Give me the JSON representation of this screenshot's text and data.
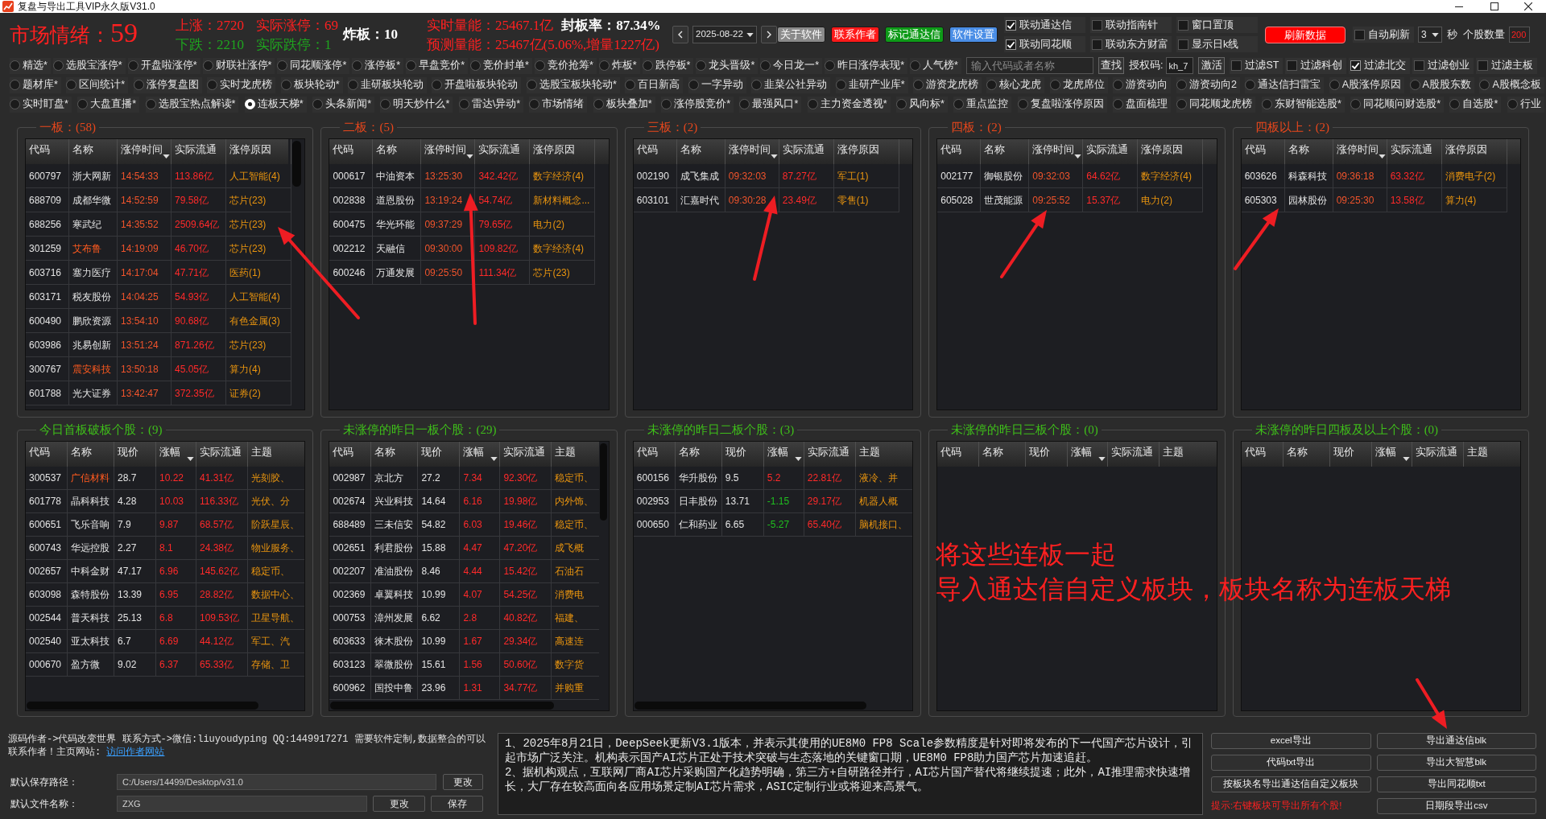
{
  "window": {
    "title": "复盘与导出工具VIP永久版V31.0"
  },
  "sentiment": {
    "label": "市场情绪：",
    "value": "59"
  },
  "stats": [
    {
      "text": "上涨：2720",
      "color": "#ff2020"
    },
    {
      "text": "实际涨停：69",
      "color": "#ff2020"
    },
    {
      "text": "下跌：2210",
      "color": "#1fa51f"
    },
    {
      "text": "实际跌停：1",
      "color": "#1fa51f"
    }
  ],
  "broken_boards": "炸板：10",
  "volume": {
    "realtime": "实时量能：25467.1亿",
    "seal_rate": "封板率：87.34%",
    "forecast": "预测量能：25467亿(5.06%,增量1227亿)"
  },
  "date_nav": {
    "date": "2025-08-22"
  },
  "top_buttons": [
    {
      "label": "关于软件",
      "color": "#8a8a8a"
    },
    {
      "label": "联系作者",
      "color": "#ff1a1a"
    },
    {
      "label": "标记通达信",
      "color": "#0e9a18"
    },
    {
      "label": "软件设置",
      "color": "#4a8ee6"
    }
  ],
  "sync_options": [
    {
      "label": "联动通达信",
      "checked": true
    },
    {
      "label": "联动指南针",
      "checked": false
    },
    {
      "label": "窗口置顶",
      "checked": false
    },
    {
      "label": "联动同花顺",
      "checked": true
    },
    {
      "label": "联动东方财富",
      "checked": false
    },
    {
      "label": "显示日k线",
      "checked": false
    }
  ],
  "refresh_button": "刷新数据",
  "auto_refresh": {
    "label": "自动刷新",
    "checked": false,
    "interval": "3",
    "unit": "秒"
  },
  "stock_count": {
    "label": "个股数量",
    "value": "200"
  },
  "view_rows": [
    {
      "items": [
        {
          "label": "精选*",
          "selected": false
        },
        {
          "label": "选股宝涨停*",
          "selected": false
        },
        {
          "label": "开盘啦涨停*",
          "selected": false
        },
        {
          "label": "财联社涨停*",
          "selected": false
        },
        {
          "label": "同花顺涨停*",
          "selected": false
        },
        {
          "label": "涨停板*",
          "selected": false
        },
        {
          "label": "早盘竞价*",
          "selected": false
        },
        {
          "label": "竞价封单*",
          "selected": false
        },
        {
          "label": "竞价抢筹*",
          "selected": false
        },
        {
          "label": "炸板*",
          "selected": false
        },
        {
          "label": "跌停板*",
          "selected": false
        },
        {
          "label": "龙头晋级*",
          "selected": false
        },
        {
          "label": "今日龙一*",
          "selected": false
        },
        {
          "label": "昨日涨停表现*",
          "selected": false
        },
        {
          "label": "人气榜*",
          "selected": false
        }
      ]
    },
    {
      "items": [
        {
          "label": "题材库*",
          "selected": false
        },
        {
          "label": "区间统计*",
          "selected": false
        },
        {
          "label": "涨停复盘图",
          "selected": false
        },
        {
          "label": "实时龙虎榜",
          "selected": false
        },
        {
          "label": "板块轮动*",
          "selected": false
        },
        {
          "label": "韭研板块轮动",
          "selected": false
        },
        {
          "label": "开盘啦板块轮动",
          "selected": false
        },
        {
          "label": "选股宝板块轮动*",
          "selected": false
        },
        {
          "label": "百日新高",
          "selected": false
        },
        {
          "label": "一字异动",
          "selected": false
        },
        {
          "label": "韭菜公社异动",
          "selected": false
        },
        {
          "label": "韭研产业库*",
          "selected": false
        },
        {
          "label": "游资龙虎榜",
          "selected": false
        },
        {
          "label": "核心龙虎",
          "selected": false
        },
        {
          "label": "龙虎席位",
          "selected": false
        },
        {
          "label": "游资动向",
          "selected": false
        },
        {
          "label": "游资动向2",
          "selected": false
        },
        {
          "label": "通达信扫雷宝",
          "selected": false
        },
        {
          "label": "A股涨停原因",
          "selected": false
        },
        {
          "label": "A股股东数",
          "selected": false
        },
        {
          "label": "A股概念板",
          "selected": false
        }
      ]
    },
    {
      "items": [
        {
          "label": "实时盯盘*",
          "selected": false
        },
        {
          "label": "大盘直播*",
          "selected": false
        },
        {
          "label": "选股宝热点解读*",
          "selected": false
        },
        {
          "label": "连板天梯*",
          "selected": true
        },
        {
          "label": "头条新闻*",
          "selected": false
        },
        {
          "label": "明天炒什么*",
          "selected": false
        },
        {
          "label": "雷达\\异动*",
          "selected": false
        },
        {
          "label": "市场情绪",
          "selected": false
        },
        {
          "label": "板块叠加*",
          "selected": false
        },
        {
          "label": "涨停股竞价*",
          "selected": false
        },
        {
          "label": "最强风口*",
          "selected": false
        },
        {
          "label": "主力资金透视*",
          "selected": false
        },
        {
          "label": "风向标*",
          "selected": false
        },
        {
          "label": "重点监控",
          "selected": false
        },
        {
          "label": "复盘啦涨停原因",
          "selected": false
        },
        {
          "label": "盘面梳理",
          "selected": false
        },
        {
          "label": "同花顺龙虎榜",
          "selected": false
        },
        {
          "label": "东财智能选股*",
          "selected": false
        },
        {
          "label": "同花顺问财选股*",
          "selected": false
        },
        {
          "label": "自选股*",
          "selected": false
        },
        {
          "label": "行业",
          "selected": false
        }
      ]
    }
  ],
  "search": {
    "placeholder": "输入代码或者名称",
    "button": "查找"
  },
  "license": {
    "label": "授权码:",
    "value": "kh_7",
    "button": "激活"
  },
  "filters": [
    {
      "label": "过滤ST",
      "checked": false
    },
    {
      "label": "过滤科创",
      "checked": false
    },
    {
      "label": "过滤北交",
      "checked": true
    },
    {
      "label": "过滤创业",
      "checked": false
    },
    {
      "label": "过滤主板",
      "checked": false
    }
  ],
  "limit_panels": [
    {
      "title": "一板：(58)",
      "columns": [
        {
          "label": "代码",
          "sorted": false
        },
        {
          "label": "名称",
          "sorted": false
        },
        {
          "label": "涨停时间",
          "sorted": true
        },
        {
          "label": "实际流通",
          "sorted": false
        },
        {
          "label": "涨停原因",
          "sorted": false
        }
      ],
      "rows": [
        {
          "code": "600797",
          "name": "浙大网新",
          "highlighted": false,
          "time": "14:54:33",
          "float": "113.86亿",
          "reason": "人工智能(4)"
        },
        {
          "code": "688709",
          "name": "成都华微",
          "highlighted": false,
          "time": "14:52:59",
          "float": "79.58亿",
          "reason": "芯片(23)"
        },
        {
          "code": "688256",
          "name": "寒武纪",
          "highlighted": false,
          "time": "14:35:52",
          "float": "2509.64亿",
          "reason": "芯片(23)"
        },
        {
          "code": "301259",
          "name": "艾布鲁",
          "highlighted": true,
          "time": "14:19:09",
          "float": "46.70亿",
          "reason": "芯片(23)"
        },
        {
          "code": "603716",
          "name": "塞力医疗",
          "highlighted": false,
          "time": "14:17:04",
          "float": "47.71亿",
          "reason": "医药(1)"
        },
        {
          "code": "603171",
          "name": "税友股份",
          "highlighted": false,
          "time": "14:04:25",
          "float": "54.93亿",
          "reason": "人工智能(4)"
        },
        {
          "code": "600490",
          "name": "鹏欣资源",
          "highlighted": false,
          "time": "13:54:10",
          "float": "90.68亿",
          "reason": "有色金属(3)"
        },
        {
          "code": "603986",
          "name": "兆易创新",
          "highlighted": false,
          "time": "13:51:24",
          "float": "871.26亿",
          "reason": "芯片(23)"
        },
        {
          "code": "300767",
          "name": "震安科技",
          "highlighted": true,
          "time": "13:50:18",
          "float": "45.05亿",
          "reason": "算力(4)"
        },
        {
          "code": "601788",
          "name": "光大证券",
          "highlighted": false,
          "time": "13:42:47",
          "float": "372.35亿",
          "reason": "证券(2)"
        }
      ]
    },
    {
      "title": "二板：(5)",
      "columns": [
        {
          "label": "代码",
          "sorted": false
        },
        {
          "label": "名称",
          "sorted": false
        },
        {
          "label": "涨停时间",
          "sorted": true
        },
        {
          "label": "实际流通",
          "sorted": false
        },
        {
          "label": "涨停原因",
          "sorted": false
        }
      ],
      "rows": [
        {
          "code": "000617",
          "name": "中油资本",
          "highlighted": false,
          "time": "13:25:30",
          "float": "342.42亿",
          "reason": "数字经济(4)"
        },
        {
          "code": "002838",
          "name": "道恩股份",
          "highlighted": false,
          "time": "13:19:24",
          "float": "54.74亿",
          "reason": "新材料概念..."
        },
        {
          "code": "600475",
          "name": "华光环能",
          "highlighted": false,
          "time": "09:37:29",
          "float": "79.65亿",
          "reason": "电力(2)"
        },
        {
          "code": "002212",
          "name": "天融信",
          "highlighted": false,
          "time": "09:30:00",
          "float": "109.82亿",
          "reason": "数字经济(4)"
        },
        {
          "code": "600246",
          "name": "万通发展",
          "highlighted": false,
          "time": "09:25:50",
          "float": "111.34亿",
          "reason": "芯片(23)"
        }
      ]
    },
    {
      "title": "三板：(2)",
      "columns": [
        {
          "label": "代码",
          "sorted": false
        },
        {
          "label": "名称",
          "sorted": false
        },
        {
          "label": "涨停时间",
          "sorted": true
        },
        {
          "label": "实际流通",
          "sorted": false
        },
        {
          "label": "涨停原因",
          "sorted": false
        }
      ],
      "rows": [
        {
          "code": "002190",
          "name": "成飞集成",
          "highlighted": false,
          "time": "09:32:03",
          "float": "87.27亿",
          "reason": "军工(1)"
        },
        {
          "code": "603101",
          "name": "汇嘉时代",
          "highlighted": false,
          "time": "09:30:28",
          "float": "23.49亿",
          "reason": "零售(1)"
        }
      ]
    },
    {
      "title": "四板：(2)",
      "columns": [
        {
          "label": "代码",
          "sorted": false
        },
        {
          "label": "名称",
          "sorted": false
        },
        {
          "label": "涨停时间",
          "sorted": true
        },
        {
          "label": "实际流通",
          "sorted": false
        },
        {
          "label": "涨停原因",
          "sorted": false
        }
      ],
      "rows": [
        {
          "code": "002177",
          "name": "御银股份",
          "highlighted": false,
          "time": "09:32:03",
          "float": "64.62亿",
          "reason": "数字经济(4)"
        },
        {
          "code": "605028",
          "name": "世茂能源",
          "highlighted": false,
          "time": "09:25:52",
          "float": "15.37亿",
          "reason": "电力(2)"
        }
      ]
    },
    {
      "title": "四板以上：(2)",
      "columns": [
        {
          "label": "代码",
          "sorted": false
        },
        {
          "label": "名称",
          "sorted": false
        },
        {
          "label": "涨停时间",
          "sorted": true
        },
        {
          "label": "实际流通",
          "sorted": false
        },
        {
          "label": "涨停原因",
          "sorted": false
        }
      ],
      "rows": [
        {
          "code": "603626",
          "name": "科森科技",
          "highlighted": false,
          "time": "09:36:18",
          "float": "63.32亿",
          "reason": "消费电子(2)"
        },
        {
          "code": "605303",
          "name": "园林股份",
          "highlighted": false,
          "time": "09:25:30",
          "float": "13.58亿",
          "reason": "算力(4)"
        }
      ]
    }
  ],
  "unsealed_panels": [
    {
      "title": "今日首板破板个股：(9)",
      "columns": [
        {
          "label": "代码",
          "sorted": false
        },
        {
          "label": "名称",
          "sorted": false
        },
        {
          "label": "现价",
          "sorted": false
        },
        {
          "label": "涨幅",
          "sorted": true
        },
        {
          "label": "实际流通",
          "sorted": false
        },
        {
          "label": "主题",
          "sorted": false
        }
      ],
      "rows": [
        {
          "code": "300537",
          "name": "广信材料",
          "highlighted": true,
          "price": "28.7",
          "change": "10.22",
          "rising": true,
          "float": "41.31亿",
          "theme": "光刻胶、"
        },
        {
          "code": "601778",
          "name": "晶科科技",
          "highlighted": false,
          "price": "4.28",
          "change": "10.03",
          "rising": true,
          "float": "116.33亿",
          "theme": "光伏、分"
        },
        {
          "code": "600651",
          "name": "飞乐音响",
          "highlighted": false,
          "price": "7.9",
          "change": "9.87",
          "rising": true,
          "float": "68.57亿",
          "theme": "阶跃星辰、"
        },
        {
          "code": "600743",
          "name": "华远控股",
          "highlighted": false,
          "price": "2.27",
          "change": "8.1",
          "rising": true,
          "float": "24.38亿",
          "theme": "物业服务、"
        },
        {
          "code": "002657",
          "name": "中科金财",
          "highlighted": false,
          "price": "47.17",
          "change": "6.96",
          "rising": true,
          "float": "145.62亿",
          "theme": "稳定币、"
        },
        {
          "code": "603098",
          "name": "森特股份",
          "highlighted": false,
          "price": "13.39",
          "change": "6.95",
          "rising": true,
          "float": "28.82亿",
          "theme": "数据中心、"
        },
        {
          "code": "002544",
          "name": "普天科技",
          "highlighted": false,
          "price": "25.13",
          "change": "6.8",
          "rising": true,
          "float": "109.53亿",
          "theme": "卫星导航、"
        },
        {
          "code": "002540",
          "name": "亚太科技",
          "highlighted": false,
          "price": "6.7",
          "change": "6.69",
          "rising": true,
          "float": "44.12亿",
          "theme": "军工、汽"
        },
        {
          "code": "000670",
          "name": "盈方微",
          "highlighted": false,
          "price": "9.02",
          "change": "6.37",
          "rising": true,
          "float": "65.33亿",
          "theme": "存储、卫"
        }
      ]
    },
    {
      "title": "未涨停的昨日一板个股：(29)",
      "columns": [
        {
          "label": "代码",
          "sorted": false
        },
        {
          "label": "名称",
          "sorted": false
        },
        {
          "label": "现价",
          "sorted": false
        },
        {
          "label": "涨幅",
          "sorted": true
        },
        {
          "label": "实际流通",
          "sorted": false
        },
        {
          "label": "主题",
          "sorted": false
        }
      ],
      "rows": [
        {
          "code": "002987",
          "name": "京北方",
          "highlighted": false,
          "price": "27.2",
          "change": "7.34",
          "rising": true,
          "float": "92.30亿",
          "theme": "稳定币、"
        },
        {
          "code": "002674",
          "name": "兴业科技",
          "highlighted": false,
          "price": "14.64",
          "change": "6.16",
          "rising": true,
          "float": "19.98亿",
          "theme": "内外饰、"
        },
        {
          "code": "688489",
          "name": "三未信安",
          "highlighted": false,
          "price": "54.82",
          "change": "6.03",
          "rising": true,
          "float": "19.46亿",
          "theme": "稳定币、"
        },
        {
          "code": "002651",
          "name": "利君股份",
          "highlighted": false,
          "price": "15.88",
          "change": "4.47",
          "rising": true,
          "float": "47.20亿",
          "theme": "成飞概"
        },
        {
          "code": "002207",
          "name": "准油股份",
          "highlighted": false,
          "price": "8.46",
          "change": "4.44",
          "rising": true,
          "float": "15.42亿",
          "theme": "石油石"
        },
        {
          "code": "002369",
          "name": "卓翼科技",
          "highlighted": false,
          "price": "10.99",
          "change": "4.07",
          "rising": true,
          "float": "54.25亿",
          "theme": "消费电"
        },
        {
          "code": "000753",
          "name": "漳州发展",
          "highlighted": false,
          "price": "6.62",
          "change": "2.8",
          "rising": true,
          "float": "40.82亿",
          "theme": "福建、"
        },
        {
          "code": "603633",
          "name": "徕木股份",
          "highlighted": false,
          "price": "10.99",
          "change": "1.67",
          "rising": true,
          "float": "29.34亿",
          "theme": "高速连"
        },
        {
          "code": "603123",
          "name": "翠微股份",
          "highlighted": false,
          "price": "15.61",
          "change": "1.56",
          "rising": true,
          "float": "50.60亿",
          "theme": "数字货"
        },
        {
          "code": "600962",
          "name": "国投中鲁",
          "highlighted": false,
          "price": "23.96",
          "change": "1.31",
          "rising": true,
          "float": "34.77亿",
          "theme": "并购重"
        }
      ]
    },
    {
      "title": "未涨停的昨日二板个股：(3)",
      "columns": [
        {
          "label": "代码",
          "sorted": false
        },
        {
          "label": "名称",
          "sorted": false
        },
        {
          "label": "现价",
          "sorted": false
        },
        {
          "label": "涨幅",
          "sorted": true
        },
        {
          "label": "实际流通",
          "sorted": false
        },
        {
          "label": "主题",
          "sorted": false
        }
      ],
      "rows": [
        {
          "code": "600156",
          "name": "华升股份",
          "highlighted": false,
          "price": "9.5",
          "change": "5.2",
          "rising": true,
          "float": "22.81亿",
          "theme": "液冷、并"
        },
        {
          "code": "002953",
          "name": "日丰股份",
          "highlighted": false,
          "price": "13.71",
          "change": "-1.15",
          "rising": false,
          "float": "29.17亿",
          "theme": "机器人概"
        },
        {
          "code": "000650",
          "name": "仁和药业",
          "highlighted": false,
          "price": "6.65",
          "change": "-5.27",
          "rising": false,
          "float": "65.40亿",
          "theme": "脑机接口、"
        }
      ]
    },
    {
      "title": "未涨停的昨日三板个股：(0)",
      "columns": [
        {
          "label": "代码",
          "sorted": false
        },
        {
          "label": "名称",
          "sorted": false
        },
        {
          "label": "现价",
          "sorted": false
        },
        {
          "label": "涨幅",
          "sorted": true
        },
        {
          "label": "实际流通",
          "sorted": false
        },
        {
          "label": "主题",
          "sorted": false
        }
      ]
    },
    {
      "title": "未涨停的昨日四板及以上个股：(0)",
      "columns": [
        {
          "label": "代码",
          "sorted": false
        },
        {
          "label": "名称",
          "sorted": false
        },
        {
          "label": "现价",
          "sorted": false
        },
        {
          "label": "涨幅",
          "sorted": true
        },
        {
          "label": "实际流通",
          "sorted": false
        },
        {
          "label": "主题",
          "sorted": false
        }
      ]
    }
  ],
  "annotation": {
    "lines": [
      "将这些连板一起",
      "导入通达信自定义板块，板块名称为连板天梯"
    ]
  },
  "footer": {
    "note": "源码作者->代码改变世界 联系方式->微信:liuyoudyping QQ:1449917271 需要软件定制,数据整合的可以联系作者！主页网站: ",
    "link": "访问作者网站",
    "save_path": {
      "label": "默认保存路径：",
      "value": "C:/Users/14499/Desktop/v31.0",
      "button": "更改"
    },
    "file_name": {
      "label": "默认文件名称：",
      "value": "ZXG",
      "buttons": [
        "更改",
        "保存"
      ]
    }
  },
  "news": [
    "1、2025年8月21日，DeepSeek更新V3.1版本，并表示其使用的UE8M0 FP8 Scale参数精度是针对即将发布的下一代国产芯片设计，引起市场广泛关注。机构表示国产AI芯片正处于技术突破与生态落地的关键窗口期，UE8M0 FP8助力国产芯片加速追赶。",
    "2、据机构观点，互联网厂商AI芯片采购国产化趋势明确，第三方+自研路径并行，AI芯片国产替代将继续提速；此外，AI推理需求快速增长，大厂存在较高面向各应用场景定制AI芯片需求，ASIC定制行业或将迎来高景气。"
  ],
  "export": [
    {
      "kind": "button",
      "label": "excel导出"
    },
    {
      "kind": "button",
      "label": "导出通达信blk"
    },
    {
      "kind": "button",
      "label": "代码txt导出"
    },
    {
      "kind": "button",
      "label": "导出大智慧blk"
    },
    {
      "kind": "button",
      "label": "按板块名导出通达信自定义板块"
    },
    {
      "kind": "button",
      "label": "导出同花顺txt"
    },
    {
      "kind": "hint",
      "label": "提示:右键板块可导出所有个股!"
    },
    {
      "kind": "button",
      "label": "日期段导出csv"
    }
  ]
}
